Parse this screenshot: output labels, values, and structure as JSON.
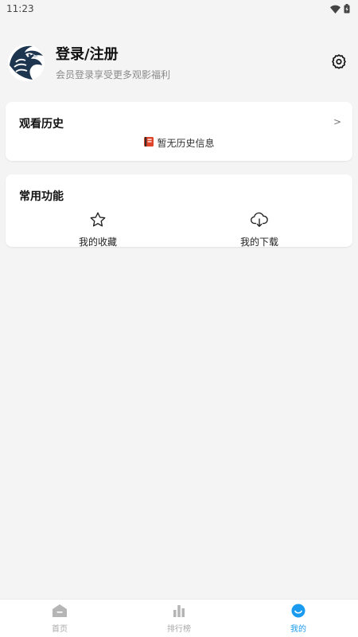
{
  "status_bar": {
    "time": "11:23"
  },
  "profile": {
    "title": "登录/注册",
    "subtitle": "会员登录享受更多观影福利",
    "avatar_icon": "eagle-logo-icon",
    "settings_icon": "gear-icon"
  },
  "history": {
    "title": "观看历史",
    "arrow": ">",
    "empty_text": "暂无历史信息",
    "empty_icon": "book-icon"
  },
  "functions": {
    "title": "常用功能",
    "items": [
      {
        "label": "我的收藏",
        "icon": "star-icon"
      },
      {
        "label": "我的下载",
        "icon": "cloud-download-icon"
      }
    ]
  },
  "bottom_nav": {
    "items": [
      {
        "label": "首页",
        "icon": "home-icon",
        "active": false
      },
      {
        "label": "排行榜",
        "icon": "bar-chart-icon",
        "active": false
      },
      {
        "label": "我的",
        "icon": "smile-icon",
        "active": true
      }
    ]
  },
  "colors": {
    "accent": "#1a9bf0",
    "background": "#f4f4f4",
    "card": "#ffffff"
  }
}
